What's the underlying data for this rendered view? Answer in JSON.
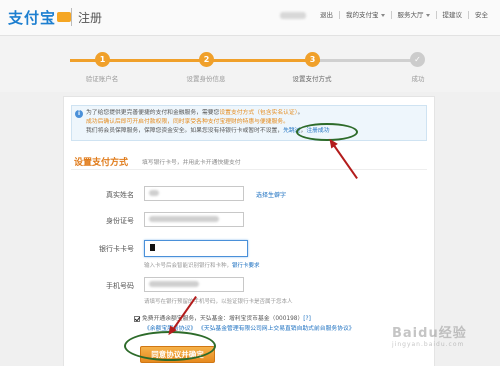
{
  "header": {
    "logo": "支付宝",
    "title": "注册",
    "links": [
      "退出",
      "我的支付宝",
      "服务大厅",
      "提建议",
      "安全"
    ]
  },
  "steps": [
    {
      "num": "1",
      "label": "验证账户名"
    },
    {
      "num": "2",
      "label": "设置身份信息"
    },
    {
      "num": "3",
      "label": "设置支付方式"
    },
    {
      "num": "✓",
      "label": "成功"
    }
  ],
  "notice": {
    "line1_a": "为了给您提供更完善便捷的支付和金融服务，需要您",
    "line1_b": "设置支付方式（包含实名认证）",
    "line1_c": "。",
    "line2": "成功后确认后即可开启付款权限，同时享受各种支付宝理财的特惠与便捷服务。",
    "line3_a": "我们将会员保障服务，保障您资金安全。如果您没有持银行卡或暂时不设置，",
    "skip": "先跳过",
    "sep": "，",
    "register": "注册成功"
  },
  "section": {
    "title": "设置支付方式",
    "subtitle": "填写银行卡号，并用此卡开通快捷支付"
  },
  "form": {
    "name_label": "真实姓名",
    "name_link": "选择生僻字",
    "id_label": "身份证号",
    "card_label": "银行卡卡号",
    "card_hint": "输入卡号后会智能识别银行和卡种，",
    "card_hint_link": "银行卡要求",
    "phone_label": "手机号码",
    "phone_hint": "请填写在银行预留的手机号码，以验证银行卡是否属于您本人"
  },
  "agree": {
    "line1": "免费开通余额宝服务，天弘基金：增利宝货币基金（000198）",
    "help": "[?]",
    "link1": "《余额宝服务协议》",
    "link2": "《天弘基金管理有限公司网上交易直销自助式前台服务协议》"
  },
  "submit_label": "同意协议并确定",
  "watermark": {
    "main": "Baidu经验",
    "sub": "jingyan.baidu.com"
  },
  "colors": {
    "accent": "#f0a02a",
    "link": "#1a6fc0",
    "brand": "#1d7fd0"
  }
}
